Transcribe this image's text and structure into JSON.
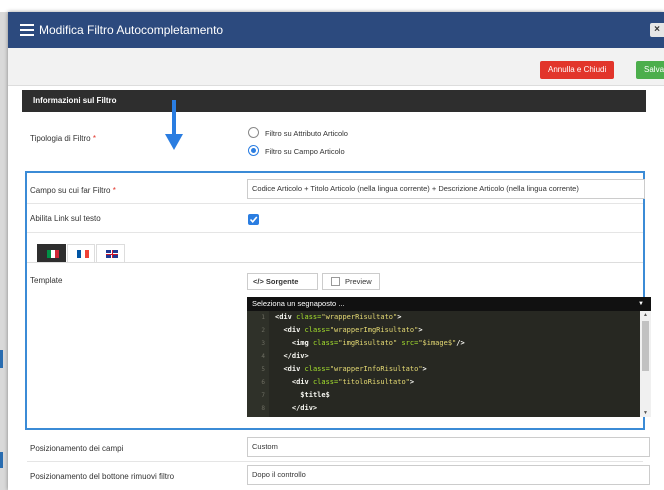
{
  "dialog": {
    "title": "Modifica Filtro Autocompletamento",
    "close_symbol": "×"
  },
  "toolbar": {
    "cancel_label": "Annulla e Chiudi",
    "save_label": "Salva"
  },
  "section": {
    "title": "Informazioni sul Filtro"
  },
  "form": {
    "filter_type": {
      "label": "Tipologia di Filtro",
      "required_mark": "*",
      "options": [
        {
          "label": "Filtro su Attributo Articolo",
          "selected": false
        },
        {
          "label": "Filtro su Campo Articolo",
          "selected": true
        }
      ]
    },
    "filter_field": {
      "label": "Campo su cui far Filtro",
      "required_mark": "*",
      "value": "Codice Articolo + Titolo Articolo (nella lingua corrente) + Descrizione Articolo (nella lingua corrente)"
    },
    "enable_link": {
      "label": "Abilita Link sul testo",
      "checked": true
    },
    "language_tabs": [
      {
        "icon": "flag-italy-icon",
        "active": true
      },
      {
        "icon": "flag-france-icon",
        "active": false
      },
      {
        "icon": "flag-uk-icon",
        "active": false
      }
    ],
    "template": {
      "label": "Template",
      "source_label": "</> Sorgente",
      "preview_label": "Preview",
      "placeholder_select": "Seleziona un segnaposto ...",
      "code_lines": [
        "1",
        "2",
        "3",
        "4",
        "5",
        "6",
        "7",
        "8"
      ]
    },
    "fields_position": {
      "label": "Posizionamento dei campi",
      "value": "Custom"
    },
    "remove_button_position": {
      "label": "Posizionamento del bottone rimuovi filtro",
      "value": "Dopo il controllo"
    }
  },
  "colors": {
    "titlebar": "#2c4a7e",
    "cancel": "#e2352b",
    "save": "#4cae4c",
    "accent": "#2a7de1",
    "highlight_border": "#3b8bd6"
  }
}
